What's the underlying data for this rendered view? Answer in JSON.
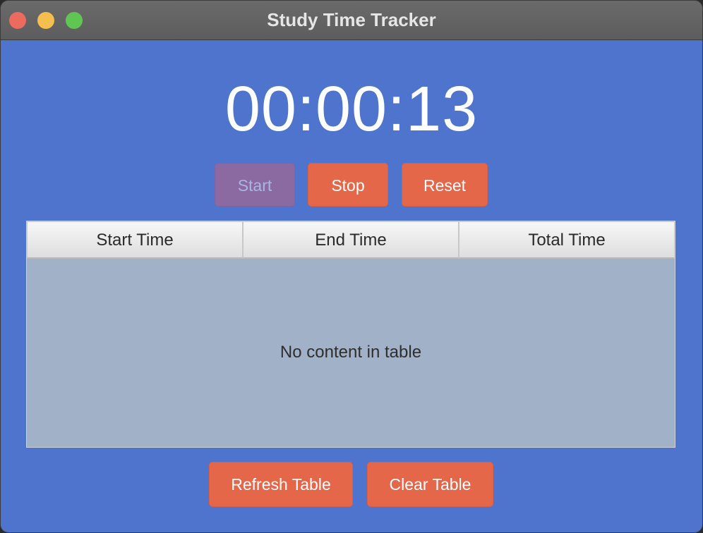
{
  "window": {
    "title": "Study Time Tracker"
  },
  "timer": {
    "display": "00:00:13"
  },
  "controls": {
    "start_label": "Start",
    "stop_label": "Stop",
    "reset_label": "Reset"
  },
  "table": {
    "columns": [
      "Start Time",
      "End Time",
      "Total Time"
    ],
    "rows": [],
    "placeholder": "No content in table"
  },
  "footer": {
    "refresh_label": "Refresh Table",
    "clear_label": "Clear Table"
  },
  "colors": {
    "background": "#4f74cd",
    "button": "#e5674a",
    "button_disabled": "#8a6aa0",
    "table_body": "#a0b1c8"
  }
}
